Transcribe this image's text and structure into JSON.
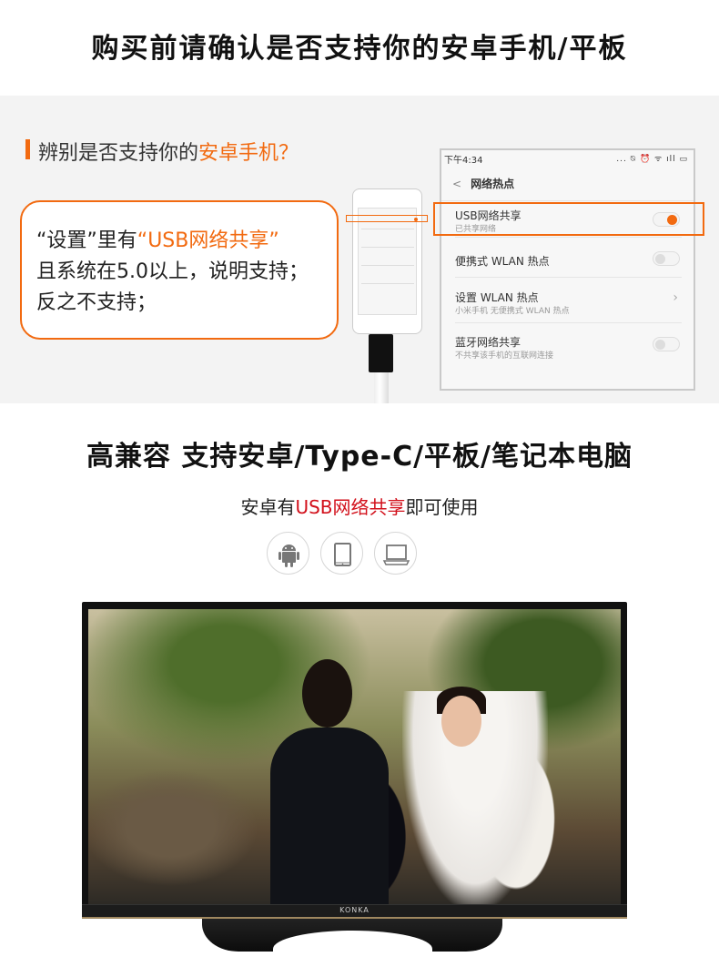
{
  "title": "购买前请确认是否支持你的安卓手机/平板",
  "check": {
    "question_prefix": "辨别是否支持你的",
    "question_highlight": "安卓手机？",
    "line1_prefix": "“设置”里有",
    "line1_highlight": "“USB网络共享”",
    "line2": "且系统在5.0以上，说明支持；",
    "line3": "反之不支持；"
  },
  "phone_screen": {
    "time": "下午4:34",
    "status_icons": "... ⍉ ⏰ ᯤ ıll ▭",
    "title": "网络热点",
    "rows": [
      {
        "label": "USB网络共享",
        "sub": "已共享网络",
        "control": "toggle",
        "on": true
      },
      {
        "label": "便携式 WLAN 热点",
        "sub": "",
        "control": "toggle",
        "on": false
      },
      {
        "label": "设置 WLAN 热点",
        "sub": "小米手机 无便携式 WLAN 热点",
        "control": "chevron"
      },
      {
        "label": "蓝牙网络共享",
        "sub": "不共享该手机的互联网连接",
        "control": "toggle",
        "on": false
      }
    ]
  },
  "compat": {
    "title": "高兼容 支持安卓/Type-C/平板/笔记本电脑",
    "sub_prefix": "安卓有",
    "sub_highlight": "USB网络共享",
    "sub_suffix": "即可使用",
    "icons": [
      "android-icon",
      "tablet-icon",
      "laptop-icon"
    ]
  },
  "tv": {
    "brand": "KONKA"
  },
  "colors": {
    "accent": "#f26a10",
    "red": "#d2101b"
  }
}
